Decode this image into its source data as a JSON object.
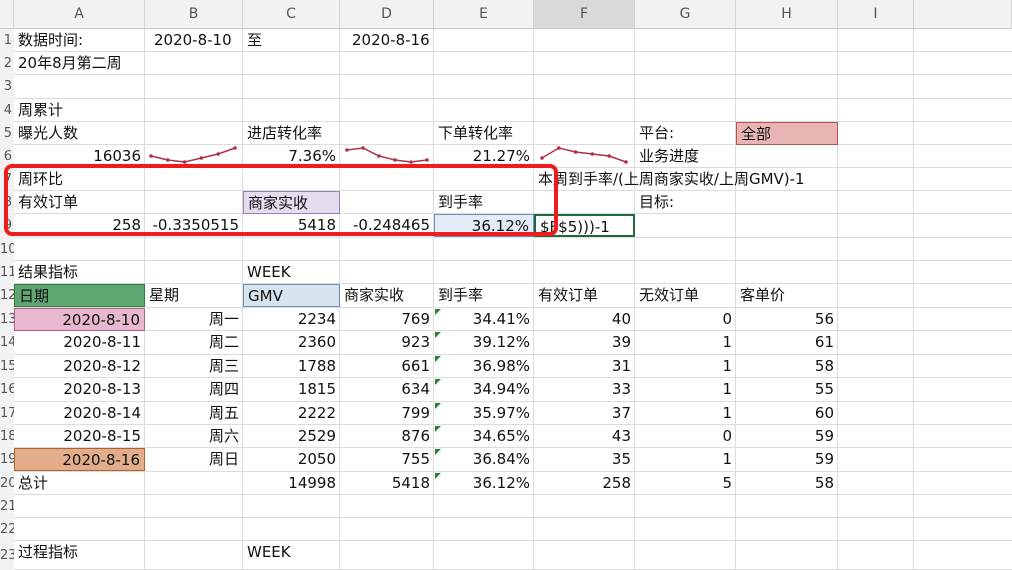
{
  "columns": [
    "A",
    "B",
    "C",
    "D",
    "E",
    "F",
    "G",
    "H",
    "I"
  ],
  "rows": [
    "1",
    "2",
    "3",
    "4",
    "5",
    "6",
    "7",
    "8",
    "9",
    "10",
    "11",
    "12",
    "13",
    "14",
    "15",
    "16",
    "17",
    "18",
    "19",
    "20",
    "21",
    "22",
    "23"
  ],
  "header_block": {
    "a1": "数据时间:",
    "b1": "2020-8-10",
    "c1": "至",
    "d1": "2020-8-16",
    "a2": "20年8月第二周",
    "a4": "周累计",
    "a5": "曝光人数",
    "c5": "进店转化率",
    "e5": "下单转化率",
    "g5": "平台:",
    "h5": "全部",
    "a6": "16036",
    "c6": "7.36%",
    "e6": "21.27%",
    "g6": "业务进度",
    "a7": "周环比",
    "f7": "本周到手率/(上周商家实收/上周GMV)-1",
    "a8": "有效订单",
    "c8": "商家实收",
    "e8": "到手率",
    "g8": "目标:",
    "a9": "258",
    "b9": "-0.3350515",
    "c9": "5418",
    "d9": "-0.248465",
    "e9": "36.12%",
    "f9": "$F$5)))-1"
  },
  "result_block": {
    "a11": "结果指标",
    "c11": "WEEK",
    "headers": [
      "日期",
      "星期",
      "GMV",
      "商家实收",
      "到手率",
      "有效订单",
      "无效订单",
      "客单价"
    ],
    "rows": [
      [
        "2020-8-10",
        "周一",
        "2234",
        "769",
        "34.41%",
        "40",
        "0",
        "56"
      ],
      [
        "2020-8-11",
        "周二",
        "2360",
        "923",
        "39.12%",
        "39",
        "1",
        "61"
      ],
      [
        "2020-8-12",
        "周三",
        "1788",
        "661",
        "36.98%",
        "31",
        "1",
        "58"
      ],
      [
        "2020-8-13",
        "周四",
        "1815",
        "634",
        "34.94%",
        "33",
        "1",
        "55"
      ],
      [
        "2020-8-14",
        "周五",
        "2222",
        "799",
        "35.97%",
        "37",
        "1",
        "60"
      ],
      [
        "2020-8-15",
        "周六",
        "2529",
        "876",
        "34.65%",
        "43",
        "0",
        "59"
      ],
      [
        "2020-8-16",
        "周日",
        "2050",
        "755",
        "36.84%",
        "35",
        "1",
        "59"
      ]
    ],
    "total": [
      "总计",
      "",
      "14998",
      "5418",
      "36.12%",
      "258",
      "5",
      "58"
    ]
  },
  "process_block": {
    "a23": "过程指标",
    "c23": "WEEK"
  },
  "colors": {
    "highlight_red": "#ee1c1c",
    "header_green": "#5fa672",
    "platform_pink": "#e8b4b4",
    "sparkline": "#b03048"
  },
  "sparklines": {
    "visitors": [
      4,
      2,
      1,
      3,
      5,
      8
    ],
    "store_conversion": [
      7,
      8,
      4,
      2,
      1,
      2
    ],
    "order_conversion": [
      3,
      8,
      6,
      5,
      4,
      1
    ]
  }
}
